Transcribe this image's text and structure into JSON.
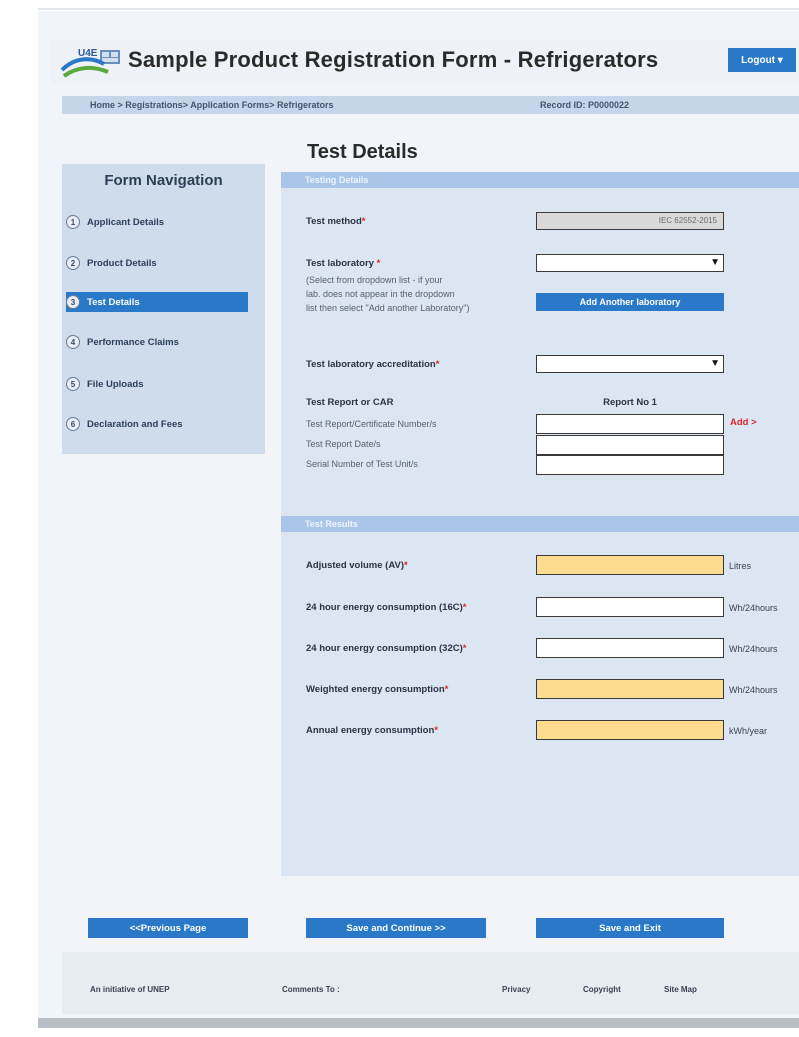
{
  "header": {
    "logo_text": "U4E",
    "title": "Sample Product Registration Form - Refrigerators",
    "logout_label": "Logout"
  },
  "breadcrumb": {
    "path": "Home > Registrations> Application Forms> Refrigerators",
    "record": "Record ID: P0000022"
  },
  "page_title": "Test Details",
  "nav": {
    "title": "Form Navigation",
    "items": [
      {
        "num": "1",
        "label": "Applicant Details"
      },
      {
        "num": "2",
        "label": "Product Details"
      },
      {
        "num": "3",
        "label": "Test Details",
        "active": true
      },
      {
        "num": "4",
        "label": "Performance Claims"
      },
      {
        "num": "5",
        "label": "File Uploads"
      },
      {
        "num": "6",
        "label": "Declaration and Fees"
      }
    ]
  },
  "testing": {
    "section_title": "Testing Details",
    "method_label": "Test method",
    "method_value": "IEC 62552-2015",
    "lab_label": "Test laboratory",
    "lab_help": [
      "(Select from dropdown list - if your",
      "lab. does not appear in the dropdown",
      "list then select \"Add another Laboratory\")"
    ],
    "add_lab_label": "Add Another laboratory",
    "accreditation_label": "Test laboratory accreditation",
    "report_label": "Test Report or CAR",
    "report_no": "Report No 1",
    "report_fields": [
      "Test Report/Certificate Number/s",
      "Test Report Date/s",
      "Serial Number of Test Unit/s"
    ],
    "add_label": "Add >"
  },
  "results": {
    "section_title": "Test Results",
    "rows": [
      {
        "label": "Adjusted volume (AV)",
        "unit": "Litres"
      },
      {
        "label": "24 hour energy consumption (16C)",
        "unit": "Wh/24hours"
      },
      {
        "label": "24 hour energy consumption (32C)",
        "unit": "Wh/24hours"
      },
      {
        "label": "Weighted energy consumption",
        "unit": "Wh/24hours"
      },
      {
        "label": "Annual energy consumption",
        "unit": "kWh/year"
      }
    ]
  },
  "buttons": {
    "previous": "<<Previous Page",
    "save_continue": "Save and Continue >>",
    "save_exit": "Save and Exit"
  },
  "footer": {
    "initiative": "An initiative of UNEP",
    "comments": "Comments To :",
    "privacy": "Privacy",
    "copyright": "Copyright",
    "sitemap": "Site Map"
  }
}
